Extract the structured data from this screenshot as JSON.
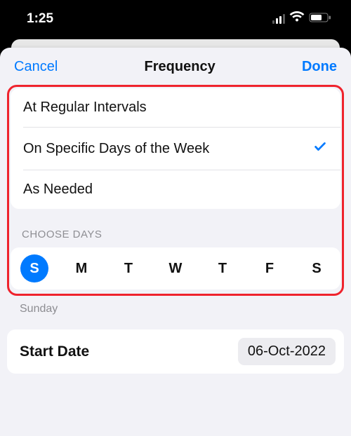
{
  "status": {
    "time": "1:25"
  },
  "nav": {
    "cancel": "Cancel",
    "title": "Frequency",
    "done": "Done"
  },
  "frequency": {
    "options": [
      {
        "label": "At Regular Intervals",
        "selected": false
      },
      {
        "label": "On Specific Days of the Week",
        "selected": true
      },
      {
        "label": "As Needed",
        "selected": false
      }
    ]
  },
  "days": {
    "header": "CHOOSE DAYS",
    "items": [
      {
        "abbr": "S",
        "selected": true
      },
      {
        "abbr": "M",
        "selected": false
      },
      {
        "abbr": "T",
        "selected": false
      },
      {
        "abbr": "W",
        "selected": false
      },
      {
        "abbr": "T",
        "selected": false
      },
      {
        "abbr": "F",
        "selected": false
      },
      {
        "abbr": "S",
        "selected": false
      }
    ],
    "footer": "Sunday"
  },
  "start": {
    "label": "Start Date",
    "value": "06-Oct-2022"
  }
}
